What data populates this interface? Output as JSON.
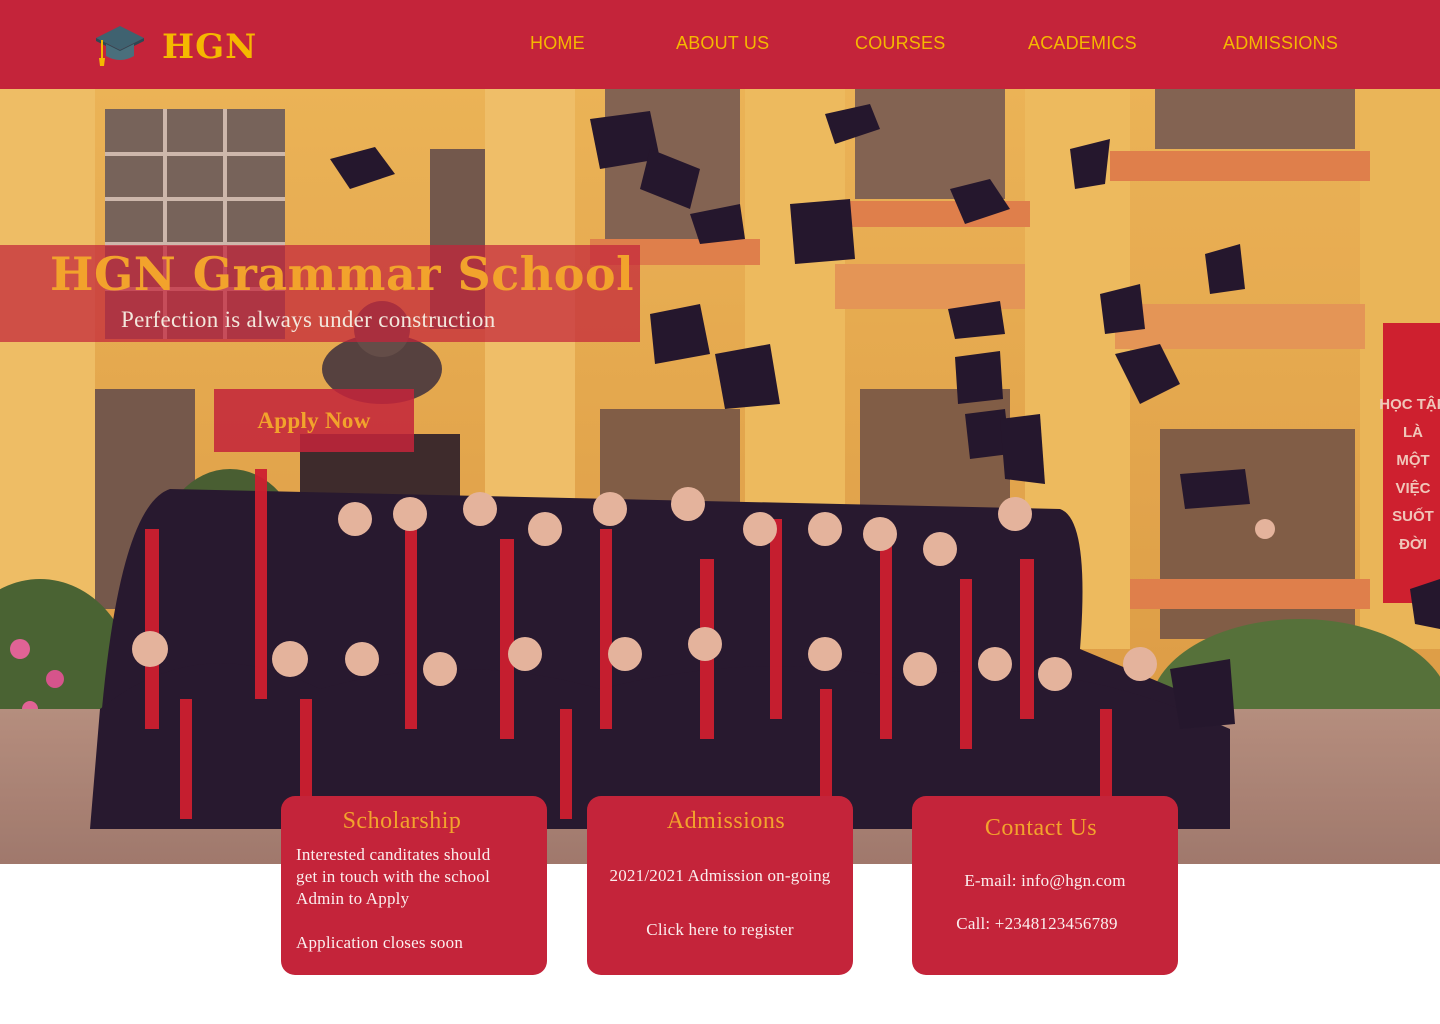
{
  "brand": {
    "name": "HGN",
    "logo_icon": "graduation-cap-icon"
  },
  "nav": {
    "items": [
      "HOME",
      "ABOUT US",
      "COURSES",
      "ACADEMICS",
      "ADMISSIONS"
    ]
  },
  "hero": {
    "title": "HGN Grammar School",
    "subtitle": "Perfection is always under construction",
    "cta_label": "Apply Now",
    "banner_text": [
      "HỌC TẬP",
      "LÀ",
      "MỘT",
      "VIỆC",
      "SUỐT",
      "ĐỜI"
    ]
  },
  "cards": {
    "scholarship": {
      "title": "Scholarship",
      "lines": [
        "Interested canditates should",
        "get in touch with the school",
        "Admin to Apply"
      ],
      "note": "Application closes soon"
    },
    "admissions": {
      "title": "Admissions",
      "status": "2021/2021 Admission on-going",
      "link": "Click here to register"
    },
    "contact": {
      "title": "Contact Us",
      "email": "E-mail: info@hgn.com",
      "phone": "Call: +2348123456789"
    }
  },
  "colors": {
    "primary": "#c4243a",
    "accent": "#f5b800",
    "title_orange": "#f2a32c",
    "white": "#ffffff"
  }
}
